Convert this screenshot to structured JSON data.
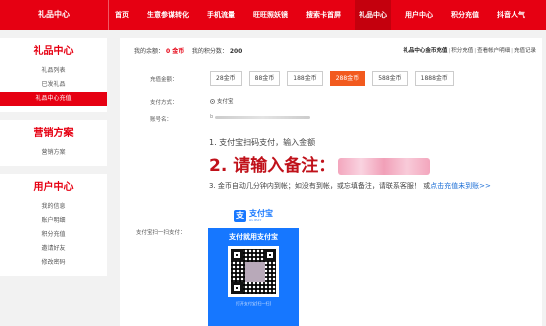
{
  "header": {
    "brand": "礼品中心",
    "nav": [
      "首页",
      "生意参谋转化",
      "手机流量",
      "旺旺照妖镜",
      "搜索卡首屏",
      "礼品中心",
      "用户中心",
      "积分充值",
      "抖音人气"
    ],
    "active_index": 5
  },
  "sidebar": {
    "gift": {
      "title": "礼品中心",
      "items": [
        "礼品列表",
        "已发礼品",
        "礼品中心充值"
      ],
      "active_index": 2
    },
    "marketing": {
      "title": "营销方案",
      "items": [
        "营销方案"
      ]
    },
    "user": {
      "title": "用户中心",
      "items": [
        "我的信息",
        "账户明细",
        "积分充值",
        "邀请好友",
        "修改密码"
      ]
    }
  },
  "main": {
    "balance_label": "我的余额：",
    "balance_value": "0 金币",
    "points_label": "我的积分数：",
    "points_value": "200",
    "links": [
      "礼品中心金币充值",
      "积分充值",
      "查看帐户明细",
      "充值记录"
    ],
    "recharge_label": "充值金额：",
    "amounts": [
      "28金币",
      "88金币",
      "188金币",
      "288金币",
      "588金币",
      "1888金币"
    ],
    "amount_active_index": 3,
    "pay_method_label": "支付方式：",
    "pay_method_value": "支付宝",
    "account_label": "账号名：",
    "account_value_prefix": "b",
    "step1": "1. 支付宝扫码支付，输入金额",
    "step2": "2. 请输入备注：",
    "step3_text": "3. 金币自动几分钟内到帐；如没有到帐，或忘填备注，请联系客服！ 或",
    "step3_link": "点击充值未到账>>",
    "scan_label": "支付宝扫一扫支付：",
    "alipay_cn": "支付宝",
    "alipay_en": "ALIPAY",
    "paycard_title": "支付就用支付宝",
    "paycard_foot": "打开支付宝[扫一扫]"
  },
  "colors": {
    "brand_red": "#e60012",
    "active_orange": "#f25a1e",
    "alipay_blue": "#1677ff"
  }
}
